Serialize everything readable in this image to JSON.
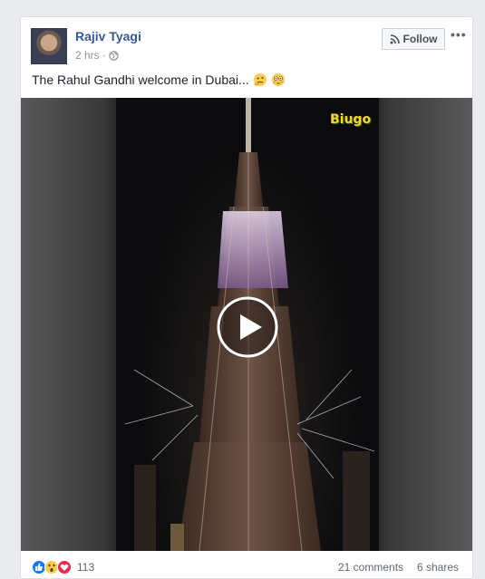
{
  "post": {
    "author": "Rajiv Tyagi",
    "time": "2 hrs",
    "separator": "·",
    "privacy_icon": "globe-icon",
    "follow_label": "Follow",
    "more_icon": "more-options-icon",
    "more_label": "•••",
    "text": "The Rahul Gandhi welcome in Dubai...",
    "emojis": [
      "thinking-face-emoji",
      "flushed-face-emoji"
    ]
  },
  "video": {
    "watermark": "Biugo",
    "play_icon": "play-icon"
  },
  "footer": {
    "reaction_icons": [
      "like-icon",
      "wow-icon",
      "love-icon"
    ],
    "reaction_count": "113",
    "comments": "21 comments",
    "shares": "6 shares"
  },
  "colors": {
    "link": "#365899",
    "text": "#1d2129",
    "muted": "#90949c",
    "like_blue": "#1877f2",
    "love_red": "#f0284a",
    "wow_yellow": "#fbcd4e"
  }
}
